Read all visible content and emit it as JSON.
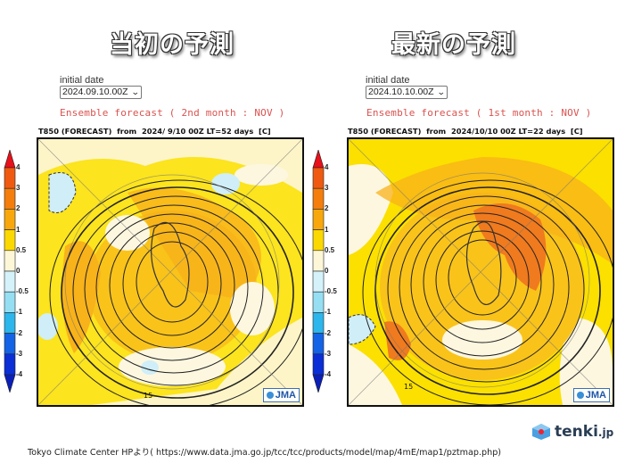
{
  "panels": [
    {
      "heading": "当初の予測",
      "initial_date_label": "initial date",
      "initial_date_value": "2024.09.10.00Z",
      "ensemble_text": "Ensemble forecast ( 2nd month : NOV )",
      "map_title": "T850 (FORECAST)  from  2024/ 9/10 00Z LT=52 days  [C]",
      "contour_label": "15",
      "badge": "JMA"
    },
    {
      "heading": "最新の予測",
      "initial_date_label": "initial date",
      "initial_date_value": "2024.10.10.00Z",
      "ensemble_text": "Ensemble forecast ( 1st month : NOV )",
      "map_title": "T850 (FORECAST)  from  2024/10/10 00Z LT=22 days  [C]",
      "contour_label": "15",
      "badge": "JMA"
    }
  ],
  "colorbar": {
    "unit": "C",
    "levels": [
      "4",
      "3",
      "2",
      "1",
      "0.5",
      "0",
      "-0.5",
      "-1",
      "-2",
      "-3",
      "-4"
    ],
    "colors": [
      "#e8101a",
      "#f05a10",
      "#f57d0c",
      "#f8a80c",
      "#fbd800",
      "#fdf7d8",
      "#d5f2fb",
      "#96dff3",
      "#2cb6ec",
      "#1463e6",
      "#0a2fd6",
      "#0a1fb8"
    ]
  },
  "footer": {
    "source_text": "Tokyo Climate Center HPより( https://www.data.jma.go.jp/tcc/tcc/products/model/map/4mE/map1/pztmap.php)"
  },
  "logo": {
    "text": "tenki",
    "suffix": ".jp"
  }
}
